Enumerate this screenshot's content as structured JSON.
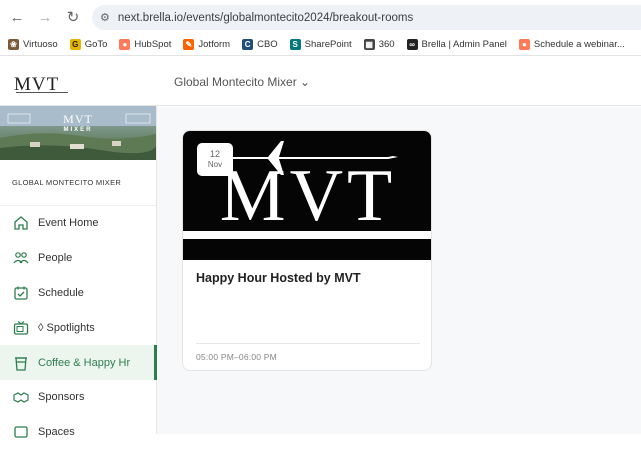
{
  "browser": {
    "url": "next.brella.io/events/globalmontecito2024/breakout-rooms",
    "bookmarks": [
      {
        "label": "Virtuoso",
        "icon": "virtuoso-icon",
        "color": "#7a5a3a"
      },
      {
        "label": "GoTo",
        "icon": "goto-icon",
        "color": "#e8b400"
      },
      {
        "label": "HubSpot",
        "icon": "hubspot-icon",
        "color": "#ff7a59"
      },
      {
        "label": "Jotform",
        "icon": "jotform-icon",
        "color": "#ff6100"
      },
      {
        "label": "CBO",
        "icon": "cbo-icon",
        "color": "#1f4e79"
      },
      {
        "label": "SharePoint",
        "icon": "sharepoint-icon",
        "color": "#03787c"
      },
      {
        "label": "360",
        "icon": "360-icon",
        "color": "#444444"
      },
      {
        "label": "Brella | Admin Panel",
        "icon": "brella-icon",
        "color": "#222222"
      },
      {
        "label": "Schedule a webinar...",
        "icon": "schedule-icon",
        "color": "#ff7a59"
      }
    ]
  },
  "header": {
    "logo_text": "MVT",
    "event_selector": "Global Montecito Mixer ⌄"
  },
  "sidebar": {
    "banner_title": "MVT",
    "banner_sub": "MIXER",
    "event_name": "GLOBAL MONTECITO MIXER",
    "items": [
      {
        "label": "Event Home",
        "icon": "home-icon",
        "active": false
      },
      {
        "label": "People",
        "icon": "people-icon",
        "active": false
      },
      {
        "label": "Schedule",
        "icon": "calendar-icon",
        "active": false
      },
      {
        "label": "◊ Spotlights",
        "icon": "tv-icon",
        "active": false
      },
      {
        "label": "Coffee & Happy Hr",
        "icon": "coffee-cup-icon",
        "active": true
      },
      {
        "label": "Sponsors",
        "icon": "sponsors-icon",
        "active": false
      },
      {
        "label": "Spaces",
        "icon": "spaces-icon",
        "active": false
      }
    ]
  },
  "card": {
    "image_text": "MVT",
    "date_day": "12",
    "date_month": "Nov",
    "title": "Happy Hour Hosted by MVT",
    "time": "05:00 PM–06:00 PM"
  },
  "colors": {
    "accent": "#2e7d4f",
    "active_bg": "#edf6ee"
  }
}
